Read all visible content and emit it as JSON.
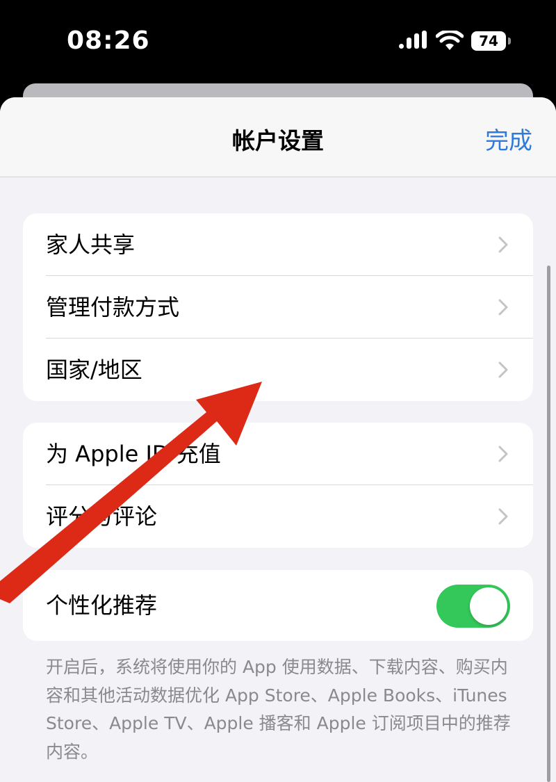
{
  "status_bar": {
    "time": "08:26",
    "battery": "74"
  },
  "nav": {
    "title": "帐户设置",
    "done_label": "完成",
    "accent_color": "#2f7bd9"
  },
  "groups": [
    {
      "items": [
        {
          "label": "家人共享",
          "icon": "chevron-right-icon"
        },
        {
          "label": "管理付款方式",
          "icon": "chevron-right-icon"
        },
        {
          "label": "国家/地区",
          "icon": "chevron-right-icon"
        }
      ]
    },
    {
      "items": [
        {
          "label": "为 Apple ID 充值",
          "icon": "chevron-right-icon"
        },
        {
          "label": "评分与评论",
          "icon": "chevron-right-icon"
        }
      ]
    },
    {
      "items": [
        {
          "label": "个性化推荐",
          "toggle_on": true,
          "toggle_color": "#34c759"
        }
      ]
    }
  ],
  "footer_note": "开启后，系统将使用你的 App 使用数据、下载内容、购买内容和其他活动数据优化 App Store、Apple Books、iTunes Store、Apple TV、Apple 播客和 Apple 订阅项目中的推荐内容。",
  "annotation": {
    "icon": "red-arrow-icon",
    "color": "#dc2a17"
  }
}
